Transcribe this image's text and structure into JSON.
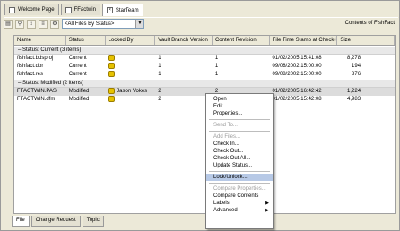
{
  "doc_tabs": [
    {
      "label": "Welcome Page",
      "icon": "page-icon"
    },
    {
      "label": "FFactwin",
      "icon": "page-icon"
    },
    {
      "label": "StarTeam",
      "icon": "close-icon"
    }
  ],
  "toolbar": {
    "filter_value": "<All Files By Status>",
    "contents_label": "Contents of FishFact"
  },
  "columns": [
    "Name",
    "Status",
    "Locked By",
    "Vault Branch Version",
    "Content Revision",
    "File Time Stamp at Check-In",
    "Size"
  ],
  "groups": [
    {
      "label": "Status: Current (3 items)",
      "rows": [
        {
          "name": "fishfact.bdsproj",
          "status": "Current",
          "locked_by": "",
          "vbv": "1",
          "cr": "1",
          "fts": "01/02/2005 15:41:08",
          "size": "8,278"
        },
        {
          "name": "fishfact.dpr",
          "status": "Current",
          "locked_by": "",
          "vbv": "1",
          "cr": "1",
          "fts": "09/08/2002 15:00:00",
          "size": "194"
        },
        {
          "name": "fishfact.res",
          "status": "Current",
          "locked_by": "",
          "vbv": "1",
          "cr": "1",
          "fts": "09/08/2002 15:00:00",
          "size": "876"
        }
      ]
    },
    {
      "label": "Status: Modified (2 items)",
      "rows": [
        {
          "name": "FFACTWIN.PAS",
          "status": "Modified",
          "locked_by": "Jason Vokes",
          "vbv": "2",
          "cr": "2",
          "fts": "01/02/2005 16:42:42",
          "size": "1,224"
        },
        {
          "name": "FFACTWIN.dfm",
          "status": "Modified",
          "locked_by": "",
          "vbv": "2",
          "cr": "",
          "fts": "01/02/2005 15:42:08",
          "size": "4,983"
        }
      ]
    }
  ],
  "bottom_tabs": [
    "File",
    "Change Request",
    "Topic"
  ],
  "menu": [
    {
      "label": "Open"
    },
    {
      "label": "Edit"
    },
    {
      "label": "Properties..."
    },
    {
      "sep": true
    },
    {
      "label": "Send To...",
      "disabled": true
    },
    {
      "sep": true
    },
    {
      "label": "Add Files...",
      "disabled": true
    },
    {
      "label": "Check In..."
    },
    {
      "label": "Check Out..."
    },
    {
      "label": "Check Out All..."
    },
    {
      "label": "Update Status..."
    },
    {
      "sep": true
    },
    {
      "label": "Lock/Unlock...",
      "highlight": true
    },
    {
      "sep": true
    },
    {
      "label": "Compare Properties...",
      "disabled": true
    },
    {
      "label": "Compare Contents"
    },
    {
      "label": "Labels",
      "submenu": true
    },
    {
      "label": "Advanced",
      "submenu": true
    }
  ]
}
